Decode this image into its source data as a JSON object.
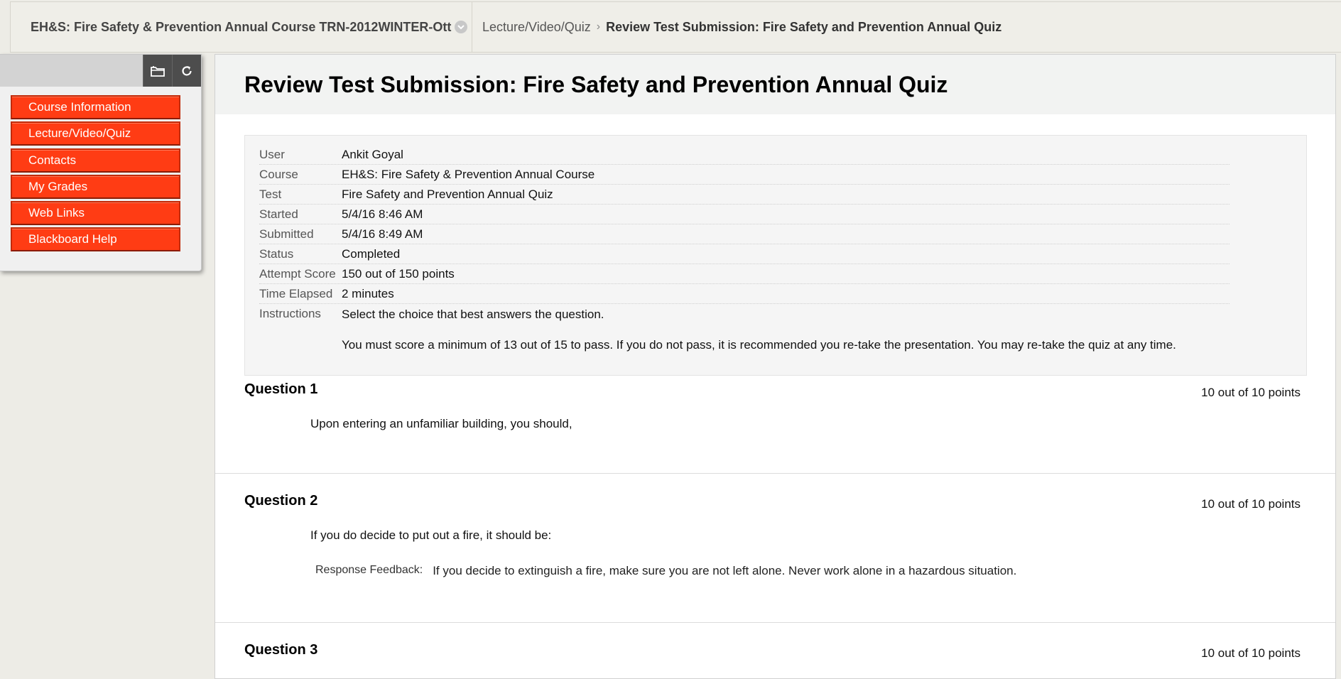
{
  "breadcrumb": {
    "course": "EH&S: Fire Safety & Prevention Annual Course TRN-2012WINTER-Ott",
    "section": "Lecture/Video/Quiz",
    "separator": "›",
    "current": "Review Test Submission: Fire Safety and Prevention Annual Quiz"
  },
  "course_menu": {
    "items": [
      {
        "label": "Course Information"
      },
      {
        "label": "Lecture/Video/Quiz"
      },
      {
        "label": "Contacts"
      },
      {
        "label": "My Grades"
      },
      {
        "label": "Web Links"
      },
      {
        "label": "Blackboard Help"
      }
    ]
  },
  "page": {
    "title": "Review Test Submission: Fire Safety and Prevention Annual Quiz"
  },
  "details": {
    "user": {
      "label": "User",
      "value": "Ankit Goyal"
    },
    "course": {
      "label": "Course",
      "value": "EH&S: Fire Safety & Prevention Annual Course"
    },
    "test": {
      "label": "Test",
      "value": "Fire Safety and Prevention Annual Quiz"
    },
    "started": {
      "label": "Started",
      "value": "5/4/16 8:46 AM"
    },
    "submitted": {
      "label": "Submitted",
      "value": "5/4/16 8:49 AM"
    },
    "status": {
      "label": "Status",
      "value": "Completed"
    },
    "attempt_score": {
      "label": "Attempt Score",
      "value": "150 out of 150 points"
    },
    "time_elapsed": {
      "label": "Time Elapsed",
      "value": "2 minutes"
    },
    "instructions": {
      "label": "Instructions",
      "line1": "Select the choice that best answers the question.",
      "line2": "You must score a minimum of 13 out of 15 to pass.  If you do not pass, it is recommended you re-take the presentation.  You may re-take the quiz at any time."
    }
  },
  "questions": [
    {
      "title": "Question 1",
      "points": "10 out of 10 points",
      "text": "Upon entering an unfamiliar building, you should,"
    },
    {
      "title": "Question 2",
      "points": "10 out of 10 points",
      "text": "If you do decide to put out a fire, it should be:",
      "feedback_label": "Response Feedback:",
      "feedback": "If you decide to extinguish a fire, make sure you are not left alone.  Never work alone in a hazardous situation."
    },
    {
      "title": "Question 3",
      "points": "10 out of 10 points"
    }
  ],
  "colors": {
    "menu_button": "#ff3c14",
    "menu_tools": "#4d4d4d",
    "page_background": "#edece6"
  }
}
